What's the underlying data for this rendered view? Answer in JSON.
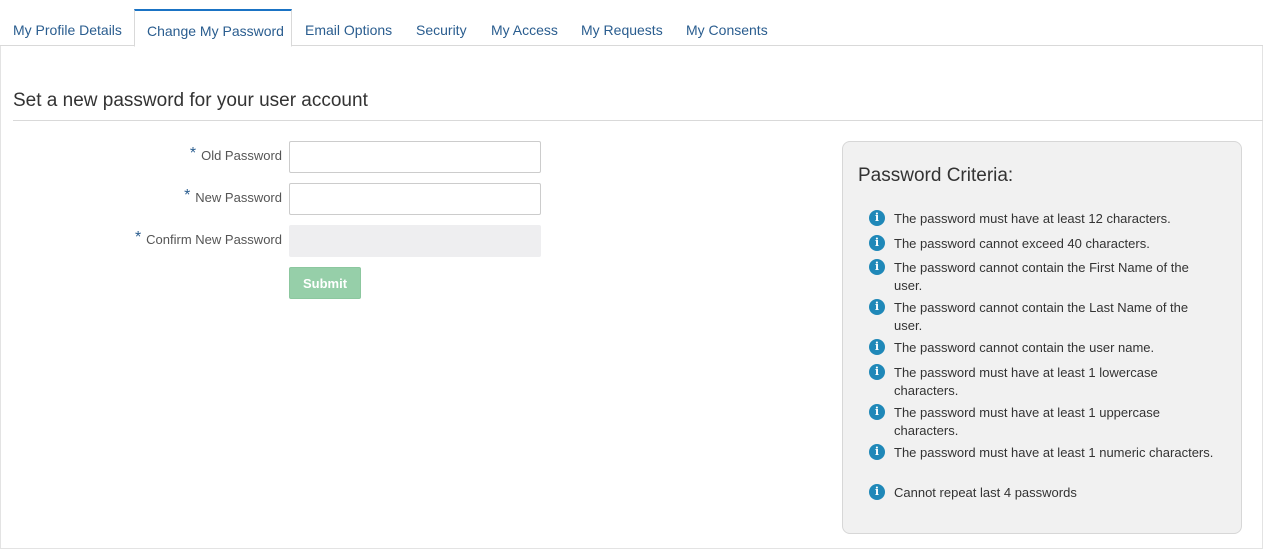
{
  "tabs": [
    {
      "label": "My Profile Details"
    },
    {
      "label": "Change My Password"
    },
    {
      "label": "Email Options"
    },
    {
      "label": "Security"
    },
    {
      "label": "My Access"
    },
    {
      "label": "My Requests"
    },
    {
      "label": "My Consents"
    }
  ],
  "active_tab": "Change My Password",
  "page_title": "Set a new password for your user account",
  "form": {
    "required_marker": "*",
    "old_password": {
      "label": "Old Password",
      "value": ""
    },
    "new_password": {
      "label": "New Password",
      "value": ""
    },
    "confirm_password": {
      "label": "Confirm New Password",
      "value": "",
      "disabled": true
    },
    "submit_label": "Submit"
  },
  "criteria": {
    "title": "Password Criteria:",
    "icon": "info-icon",
    "items": [
      "The password must have at least 12 characters.",
      "The password cannot exceed 40 characters.",
      "The password cannot contain the First Name of the user.",
      "The password cannot contain the Last Name of the user.",
      "The password cannot contain the user name.",
      "The password must have at least 1 lowercase characters.",
      "The password must have at least 1 uppercase characters.",
      "The password must have at least 1 numeric characters.",
      "Cannot repeat last 4 passwords"
    ]
  },
  "colors": {
    "link_blue": "#2a5d8f",
    "active_tab_accent": "#1a73c4",
    "submit_green": "#96cfa9",
    "info_icon_blue": "#1f88b8",
    "criteria_bg": "#f1f1f1"
  }
}
